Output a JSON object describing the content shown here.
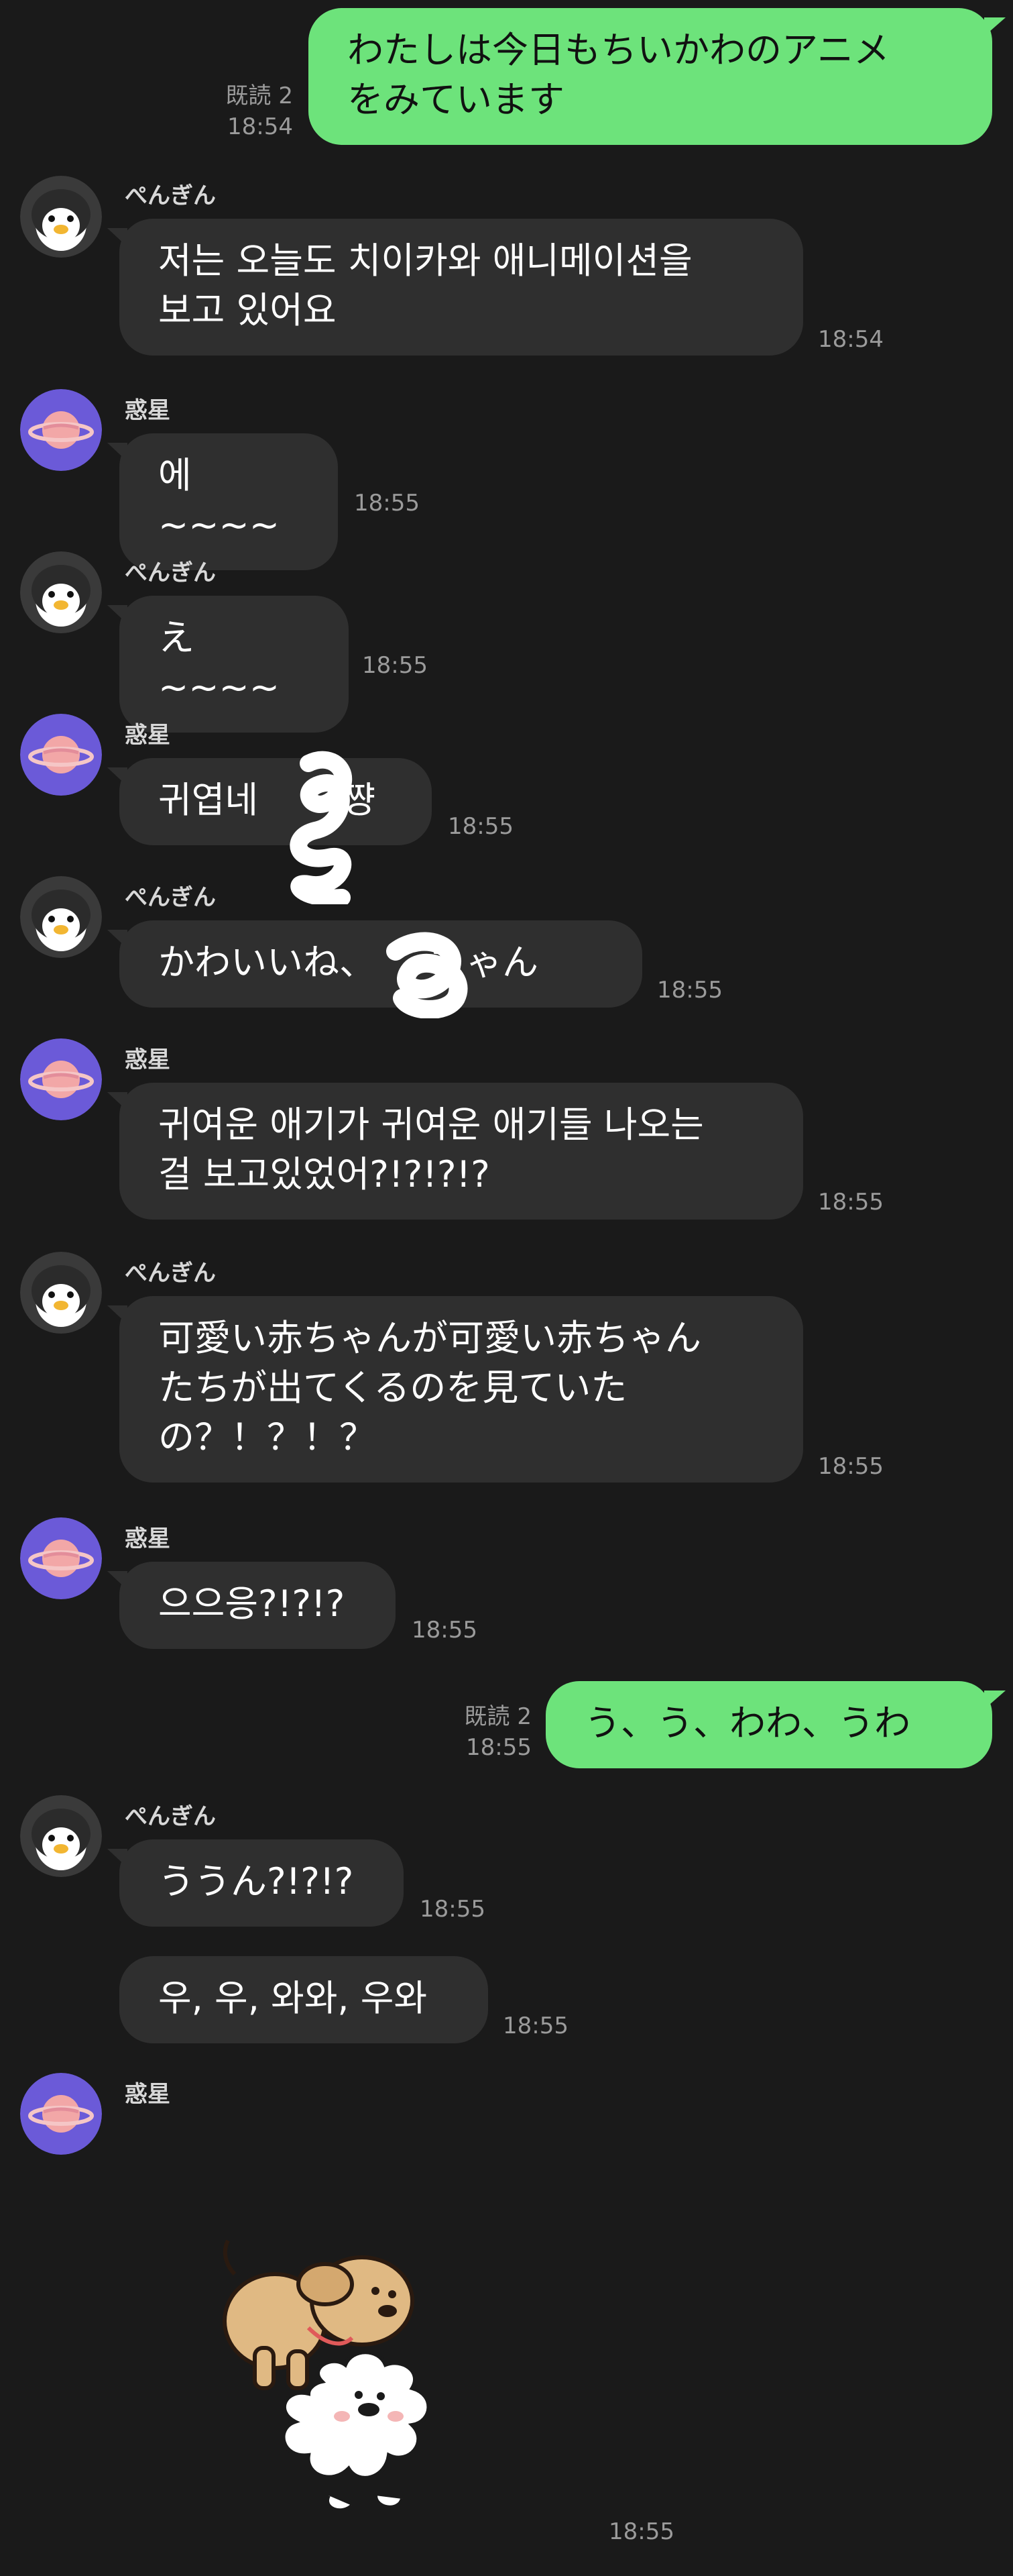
{
  "messages": [
    {
      "text": "わたしは今日もちいかわのアニメ\nをみています",
      "read": "既読 2",
      "time": "18:54"
    },
    {
      "sender": "ぺんぎん",
      "text": "저는 오늘도 치이카와 애니메이션을\n보고 있어요",
      "time": "18:54"
    },
    {
      "sender": "惑星",
      "text": "에~~~~",
      "time": "18:55"
    },
    {
      "sender": "ぺんぎん",
      "text": "え~~~~",
      "time": "18:55"
    },
    {
      "sender": "惑星",
      "text": "귀엽네 　　쨩",
      "time": "18:55"
    },
    {
      "sender": "ぺんぎん",
      "text": "かわいいね、　　ちゃん",
      "time": "18:55"
    },
    {
      "sender": "惑星",
      "text": "귀여운 애기가 귀여운 애기들 나오는\n걸 보고있었어?!?!?!?",
      "time": "18:55"
    },
    {
      "sender": "ぺんぎん",
      "text": "可愛い赤ちゃんが可愛い赤ちゃん\nたちが出てくるのを見ていた\nの？！？！？",
      "time": "18:55"
    },
    {
      "sender": "惑星",
      "text": "으으응?!?!?",
      "time": "18:55"
    },
    {
      "text": "う、う、わわ、うわ",
      "read": "既読 2",
      "time": "18:55"
    },
    {
      "sender": "ぺんぎん",
      "text": "ううん?!?!?",
      "time": "18:55"
    },
    {
      "text": "우, 우, 와와, 우와",
      "time": "18:55"
    },
    {
      "sender": "惑星",
      "time": "18:55"
    }
  ],
  "colors": {
    "background": "#1a1a1a",
    "incoming_bubble": "#2f2f2f",
    "outgoing_bubble": "#6de37b",
    "timestamp": "#9b9b9b",
    "planet_avatar": "#6b5ad8"
  },
  "icons": {
    "penguin": "penguin-avatar-icon",
    "planet": "planet-avatar-icon",
    "sticker": "dog-sticker"
  }
}
